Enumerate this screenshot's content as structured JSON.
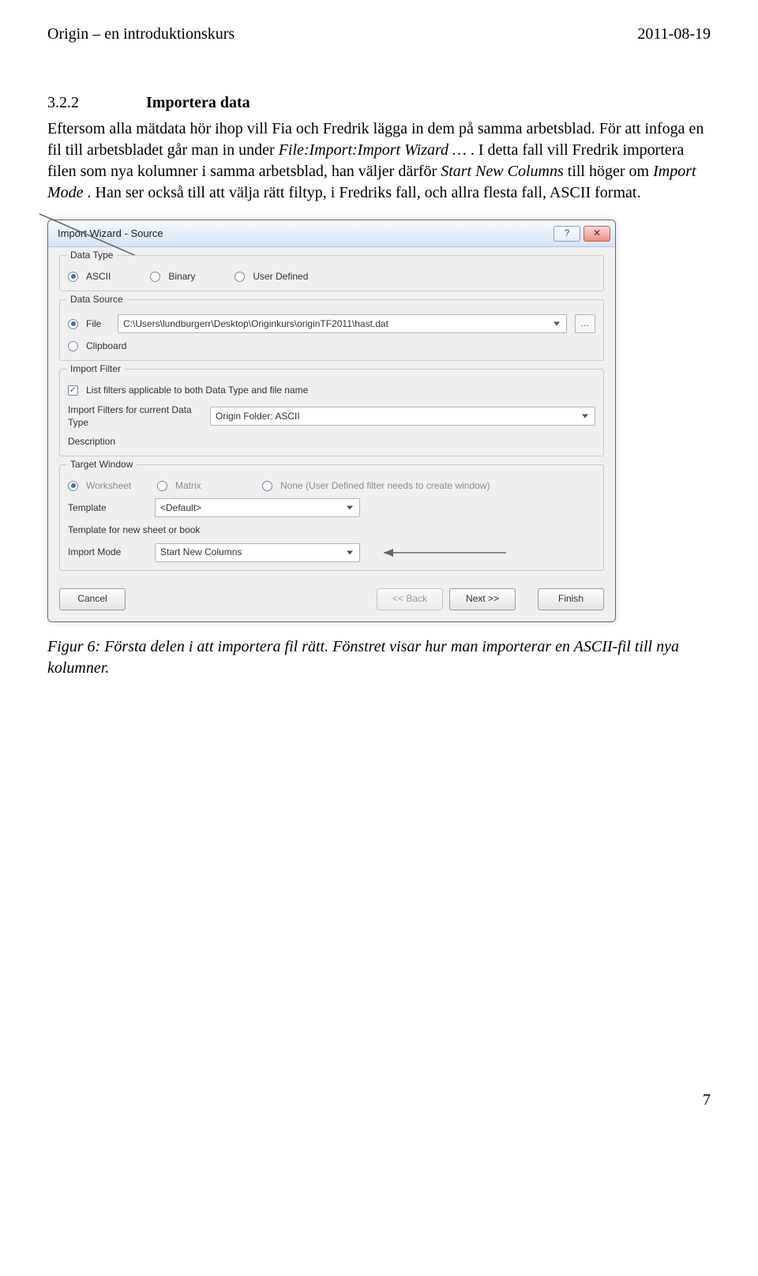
{
  "doc": {
    "header_left": "Origin – en introduktionskurs",
    "header_right": "2011-08-19",
    "section_number": "3.2.2",
    "section_title": "Importera data",
    "para1a": "Eftersom alla mätdata hör ihop vill Fia och Fredrik lägga in dem på samma arbetsblad. För att infoga en fil till arbetsbladet går man in under ",
    "para1b": "File:Import:Import Wizard …",
    "para1c": ". I detta fall vill Fredrik importera filen som nya kolumner i samma arbetsblad, han väljer därför ",
    "para1d": "Start New Columns",
    "para1e": " till höger om ",
    "para1f": "Import Mode",
    "para1g": ". Han ser också till att välja rätt filtyp, i Fredriks fall, och allra flesta fall, ASCII format.",
    "caption": "Figur 6: Första delen i att importera fil rätt. Fönstret visar hur man importerar en ASCII-fil till nya kolumner.",
    "page_number": "7"
  },
  "dlg": {
    "title": "Import Wizard - Source",
    "help_icon": "?",
    "close_icon": "✕",
    "grp_data_type": "Data Type",
    "opt_ascii": "ASCII",
    "opt_binary": "Binary",
    "opt_userdef": "User Defined",
    "grp_data_source": "Data Source",
    "opt_file": "File",
    "file_path": "C:\\Users\\lundburgerr\\Desktop\\Originkurs\\originTF2011\\hast.dat",
    "browse_dots": "…",
    "opt_clipboard": "Clipboard",
    "grp_import_filter": "Import Filter",
    "chk_list_filters": "List filters applicable to both Data Type and file name",
    "lbl_filters_for": "Import Filters for current Data Type",
    "val_filters_for": "Origin Folder: ASCII",
    "lbl_description": "Description",
    "grp_target": "Target Window",
    "opt_worksheet": "Worksheet",
    "opt_matrix": "Matrix",
    "opt_none": "None (User Defined filter needs to create window)",
    "lbl_template": "Template",
    "val_template": "<Default>",
    "lbl_template_new": "Template for new sheet or book",
    "lbl_import_mode": "Import Mode",
    "val_import_mode": "Start New Columns",
    "btn_cancel": "Cancel",
    "btn_back": "<< Back",
    "btn_next": "Next >>",
    "btn_finish": "Finish"
  }
}
